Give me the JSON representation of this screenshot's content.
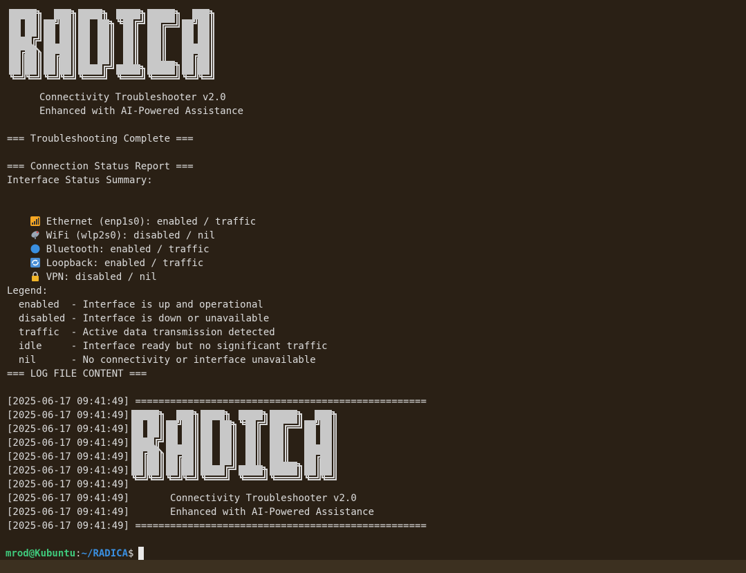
{
  "banner": {
    "logo_text": "RADICA",
    "subtitle1": "Connectivity Troubleshooter v2.0",
    "subtitle2": "Enhanced with AI-Powered Assistance"
  },
  "sections": {
    "complete": "=== Troubleshooting Complete ===",
    "report": "=== Connection Status Report ===",
    "summary": "Interface Status Summary:"
  },
  "interfaces": [
    {
      "icon": "signal-bars-icon",
      "text": "Ethernet (enp1s0): enabled / traffic"
    },
    {
      "icon": "satellite-antenna-icon",
      "text": "WiFi (wlp2s0): disabled / nil"
    },
    {
      "icon": "blue-circle-icon",
      "text": "Bluetooth: enabled / traffic"
    },
    {
      "icon": "loop-arrows-icon",
      "text": "Loopback: enabled / traffic"
    },
    {
      "icon": "lock-icon",
      "text": "VPN: disabled / nil"
    }
  ],
  "legend": {
    "title": "Legend:",
    "items": [
      "  enabled  - Interface is up and operational",
      "  disabled - Interface is down or unavailable",
      "  traffic  - Active data transmission detected",
      "  idle     - Interface ready but no significant traffic",
      "  nil      - No connectivity or interface unavailable"
    ]
  },
  "log": {
    "header": "=== LOG FILE CONTENT ===",
    "timestamp": "[2025-06-17 09:41:49]",
    "separator": "==================================================",
    "subtitle1": "      Connectivity Troubleshooter v2.0",
    "subtitle2": "      Enhanced with AI-Powered Assistance"
  },
  "prompt": {
    "user_host": "mrod@Kubuntu",
    "colon": ":",
    "path": "~/RADICA",
    "dollar": "$"
  },
  "colors": {
    "background": "#2a2015",
    "text": "#dcdcdc",
    "user_host": "#3fc97c",
    "path": "#3a8fe0"
  }
}
